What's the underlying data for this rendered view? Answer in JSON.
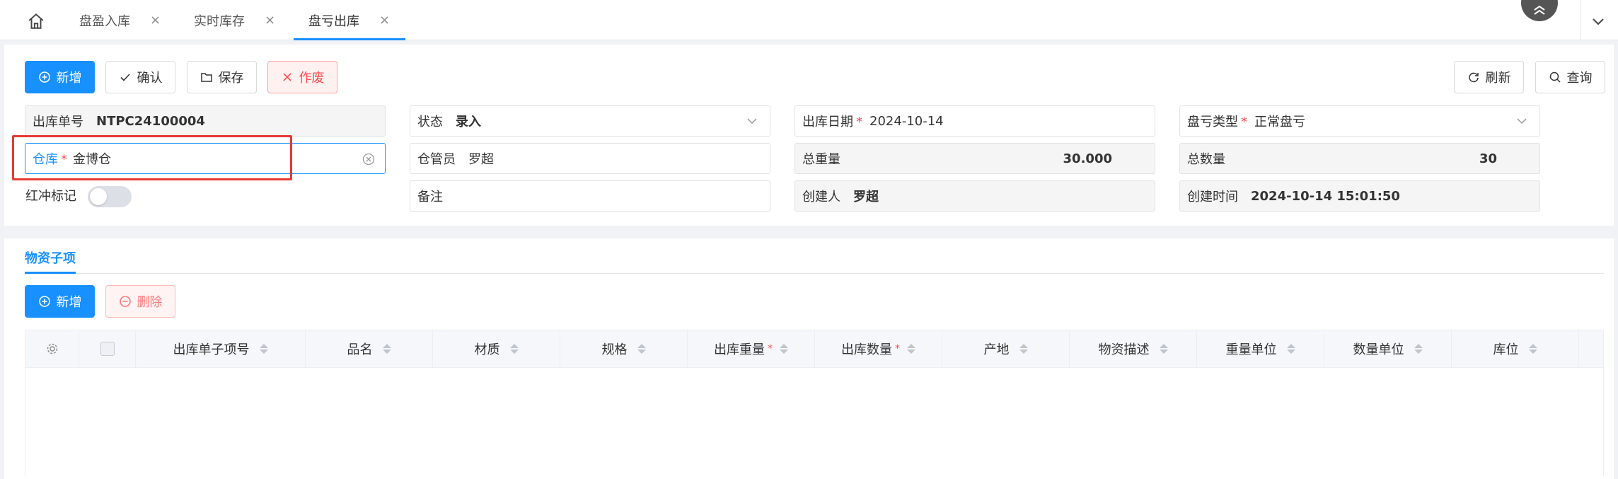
{
  "tabs": [
    {
      "label": "盘盈入库",
      "close": "×"
    },
    {
      "label": "实时库存",
      "close": "×"
    },
    {
      "label": "盘亏出库",
      "close": "×",
      "active": true
    }
  ],
  "toolbar": {
    "add": "新增",
    "confirm": "确认",
    "save": "保存",
    "void": "作废",
    "refresh": "刷新",
    "query": "查询"
  },
  "form": {
    "order_no": {
      "label": "出库单号",
      "value": "NTPC24100004"
    },
    "status": {
      "label": "状态",
      "value": "录入"
    },
    "out_date": {
      "label": "出库日期",
      "required": "*",
      "value": "2024-10-14"
    },
    "loss_type": {
      "label": "盘亏类型",
      "required": "*",
      "value": "正常盘亏"
    },
    "warehouse": {
      "label": "仓库",
      "required": "*",
      "value": "金博仓"
    },
    "keeper": {
      "label": "仓管员",
      "value": "罗超"
    },
    "total_weight": {
      "label": "总重量",
      "value": "30.000"
    },
    "total_qty": {
      "label": "总数量",
      "value": "30"
    },
    "red_flag": {
      "label": "红冲标记",
      "on": false
    },
    "remark": {
      "label": "备注",
      "value": ""
    },
    "creator": {
      "label": "创建人",
      "value": "罗超"
    },
    "created_at": {
      "label": "创建时间",
      "value": "2024-10-14 15:01:50"
    }
  },
  "items_section": {
    "tab": "物资子项",
    "add": "新增",
    "delete": "删除"
  },
  "table": {
    "columns": [
      {
        "label": "出库单子项号",
        "required": ""
      },
      {
        "label": "品名",
        "required": ""
      },
      {
        "label": "材质",
        "required": ""
      },
      {
        "label": "规格",
        "required": ""
      },
      {
        "label": "出库重量",
        "required": "*"
      },
      {
        "label": "出库数量",
        "required": "*"
      },
      {
        "label": "产地",
        "required": ""
      },
      {
        "label": "物资描述",
        "required": ""
      },
      {
        "label": "重量单位",
        "required": ""
      },
      {
        "label": "数量单位",
        "required": ""
      },
      {
        "label": "库位",
        "required": ""
      }
    ],
    "rows": []
  },
  "colors": {
    "primary": "#1890ff",
    "danger": "#ff4d4f",
    "highlight": "#e53935"
  }
}
